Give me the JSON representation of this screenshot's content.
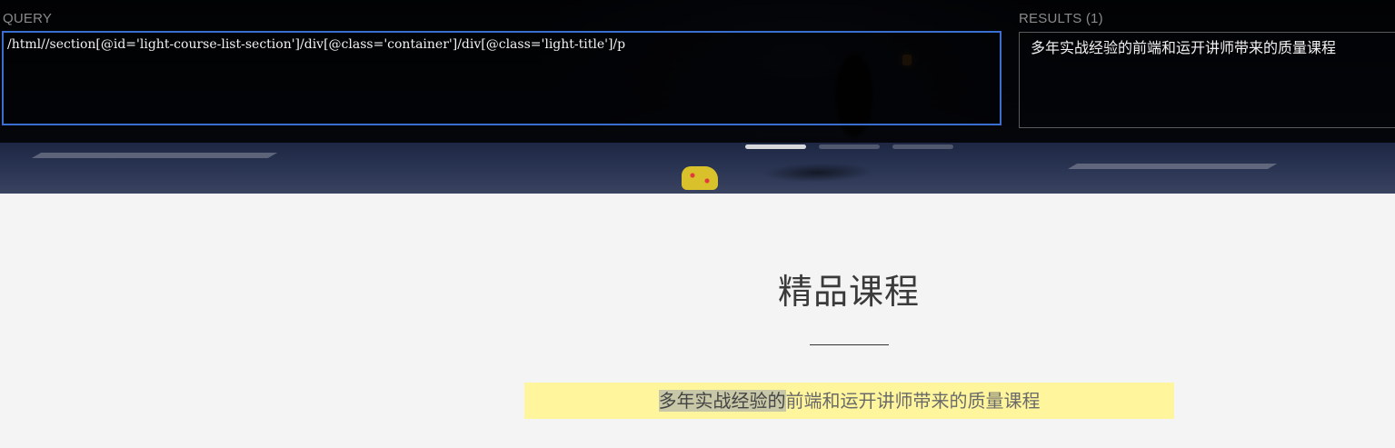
{
  "query_panel": {
    "label": "QUERY",
    "value": "/html//section[@id='light-course-list-section']/div[@class='container']/div[@class='light-title']/p"
  },
  "results_panel": {
    "label": "RESULTS (1)",
    "items": [
      "多年实战经验的前端和运开讲师带来的质量课程"
    ]
  },
  "carousel": {
    "active_index": 0,
    "count": 3
  },
  "section": {
    "title": "精品课程",
    "subtitle_highlight": "多年实战经验的",
    "subtitle_rest": "前端和运开讲师带来的质量课程"
  },
  "colors": {
    "query_border": "#3a6ed1",
    "match_highlight": "#fff59d"
  }
}
